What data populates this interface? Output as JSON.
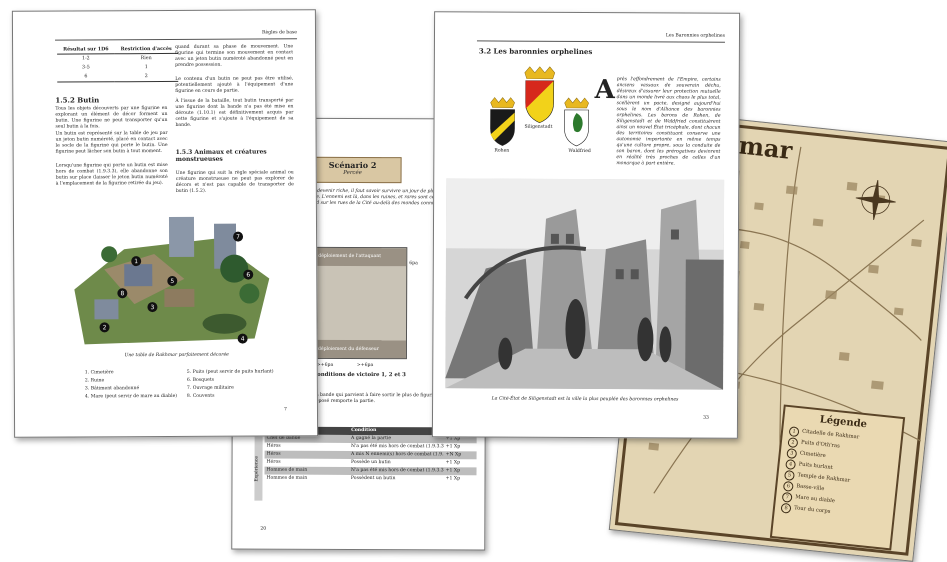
{
  "page_left": {
    "header": "Règles de base",
    "table": {
      "headers": [
        "Résultat sur 1D6",
        "Restriction d'accès"
      ],
      "rows": [
        [
          "1-2",
          "Rien"
        ],
        [
          "3-5",
          "1"
        ],
        [
          "6",
          "2"
        ]
      ]
    },
    "section_heading": "1.5.2  Butin",
    "para1": "Tous les objets découverts par une figurine en explorant un élément de décor forment un butin. Une figurine ne peut transporter qu'un seul butin à la fois.",
    "para2": "Un butin est représenté sur la table de jeu par un jeton butin numéroté, placé en contact avec le socle de la figurine qui porte le butin. Une figurine peut lâcher son butin à tout moment.",
    "para3": "Lorsqu'une figurine qui porte un butin est mise hors de combat (1.9.3.3), elle abandonne son butin sur place (laisser le jeton butin numéroté à l'emplacement de la figurine retirée du jeu).",
    "right_col1": "quand durant sa phase de mouvement. Une figurine qui termine son mouvement en contact avec un jeton butin numéroté abandonné peut en prendre possession.",
    "right_col2": "Le contenu d'un butin ne peut pas être utilisé, potentiellement ajouté à l'équipement d'une figurine en cours de partie.",
    "right_col3": "À l'issue de la bataille, tout butin transporté par une figurine dont la bande n'a pas été mise en déroute (1.10.1) est définitivement acquis par cette figurine et s'ajoute à l'équipement de sa bande.",
    "section_heading2": "1.5.3  Animaux et créatures monstrueuses",
    "right_col4": "Une figurine qui suit la règle spéciale animal ou créature monstrueuse ne peut pas explorer de décors et n'est pas capable de transporter de butin (1.5.2).",
    "image_caption": "Une table de Rakhmar parfaitement décorée",
    "legend_left": [
      "1. Cimetière",
      "2. Ruine",
      "3. Bâtiment abandonné",
      "4. Mare (peut servir de mare au diable)"
    ],
    "legend_right": [
      "5. Puits (peut servir de puits hurlant)",
      "6. Bosquets",
      "7. Ouvrage militaire",
      "8. Couvents"
    ],
    "page_number": "7"
  },
  "page_center": {
    "scenario_title": "Scénario 2",
    "scenario_subtitle": "Percée",
    "intro": "Avoir devenir riche, il faut savoir survivre un jour de plus à la cohue de la ville. L'ennemi est là, dans les ruines, et rares sont ceux qui osent un regard sur les rues de la Cité au-delà des mondes connus.",
    "zone_label_top": "déploiement de l'attaquant",
    "zone_label_bottom": "déploiement du défenseur",
    "measure1": ">+6pa",
    "measure2": ">+6pa",
    "side_label": "6pa",
    "victory_heading": "Conditions de victoire 1, 2 et 3",
    "victory_text": "La bande qui parvient à faire sortir le plus de figurines par le bord opposé remporte la partie.",
    "xp_table": {
      "headers": [
        "Bénéficiaire(s)",
        "Condition",
        "Expérience"
      ],
      "side_label": "Expérience",
      "rows": [
        [
          "Chef de bande",
          "A gagné la partie",
          "+1 Xp"
        ],
        [
          "Héros",
          "N'a pas été mis hors de combat (1.9.3.3)",
          "+1 Xp"
        ],
        [
          "Héros",
          "A mis N ennemi(s) hors de combat (1.9.3.3)",
          "+N Xp"
        ],
        [
          "Héros",
          "Possède un butin",
          "+1 Xp"
        ],
        [
          "Hommes de main",
          "N'a pas été mis hors de combat (1.9.3.3)",
          "+1 Xp"
        ],
        [
          "Hommes de main",
          "Possèdent un butin",
          "+1 Xp"
        ]
      ]
    },
    "page_number": "20"
  },
  "page_right": {
    "header": "Les Baronnies orphelines",
    "section_heading": "3.2  Les baronnies orphelines",
    "dropcap": "A",
    "body": "près l'effondrement de l'Empire, certains anciens vassaux de souverain déchu, désireux d'assurer leur protection mutuelle dans un monde livré aux chaos le plus total, scellèrent un pacte, designé aujourd'hui sous le nom d'Alliance des baronnies orphelines. Les barons de Rohen, de Siligenstadt et de Waldfried constituèrent ainsi un nouvel État tricéphale, dont chacun des territoires constituant conserve une autonomie importante en même temps qu'une culture propre, sous la conduite de son baron, dont les prérogatives devinrent en réalité très proches de celles d'un monarque à part entière.",
    "shield_labels": [
      "Rohen",
      "Siligenstadt",
      "Waldfried"
    ],
    "image_caption": "La Cité-État de Siligenstadt est la ville la plus peuplée des baronnies orphelines",
    "page_number": "33"
  },
  "page_map": {
    "title": "Rakhmar",
    "legend_title": "Légende",
    "legend_items": [
      "Citadelle de Rakhmar",
      "Puits d'Oth'ras",
      "Cimetière",
      "Puits hurlant",
      "Temple de Rakhmar",
      "Basse-ville",
      "Mare au diable",
      "Tour du corps"
    ]
  },
  "colors": {
    "parchment": "#e6d9b8",
    "map_ink": "#4a3820",
    "xp_header": "#444444",
    "shield_black": "#1a1a1a",
    "shield_yellow": "#f2d21a",
    "shield_red": "#d6281c",
    "shield_green": "#2d7a2d"
  }
}
